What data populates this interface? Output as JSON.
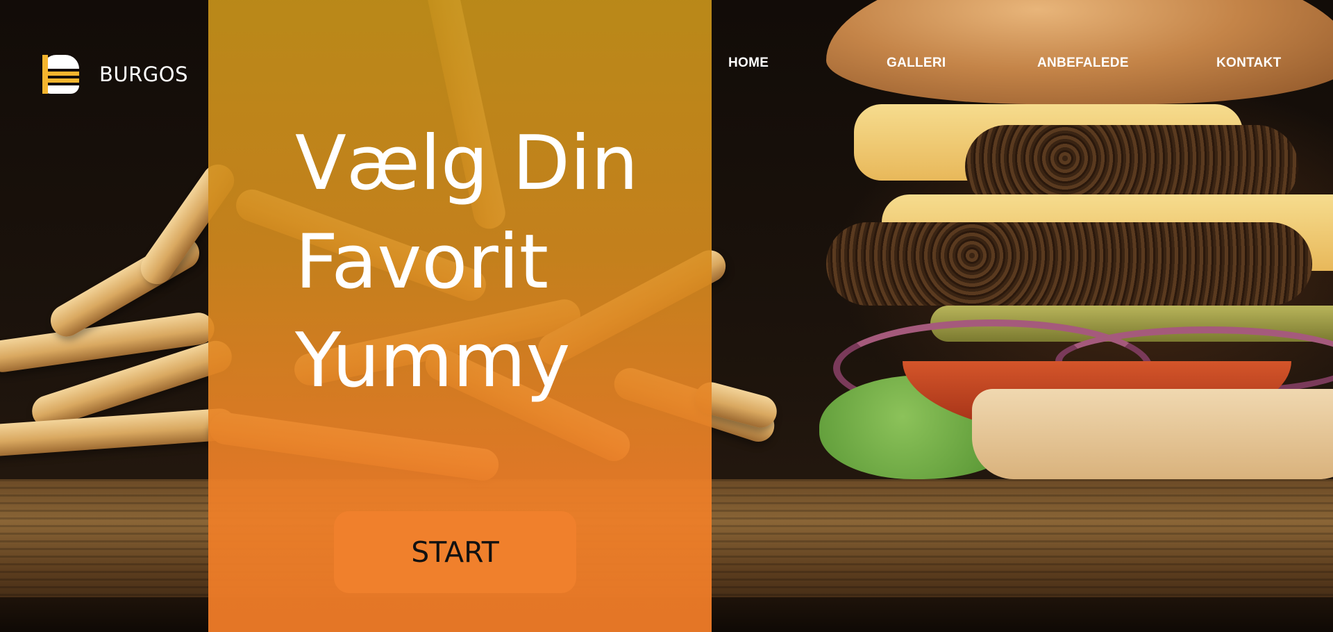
{
  "brand": {
    "name": "BURGOS"
  },
  "nav": {
    "items": [
      {
        "label": "HOME"
      },
      {
        "label": "GALLERI"
      },
      {
        "label": "ANBEFALEDE"
      },
      {
        "label": "KONTAKT"
      }
    ]
  },
  "hero": {
    "line1": "Vælg Din",
    "line2": "Favorit",
    "line3": "Yummy",
    "cta_label": "START"
  },
  "colors": {
    "panel": "#d68c1e",
    "button": "#f0802c",
    "logo_accent": "#f5b52e"
  }
}
